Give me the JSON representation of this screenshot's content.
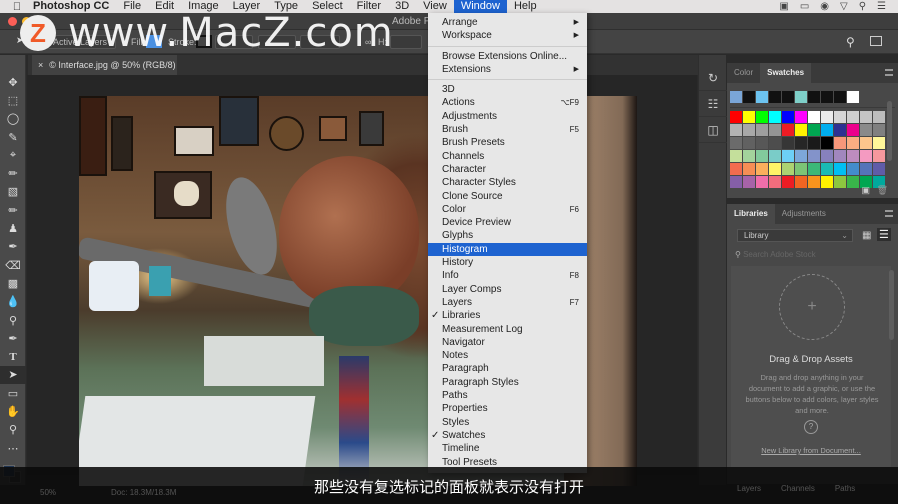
{
  "menubar": {
    "app_name": "Photoshop CC",
    "items": [
      "File",
      "Edit",
      "Image",
      "Layer",
      "Type",
      "Select",
      "Filter",
      "3D",
      "View",
      "Window",
      "Help"
    ],
    "active": "Window"
  },
  "titlebar": {
    "title": "Adobe P"
  },
  "optionsbar": {
    "layers_select": "Active Layers",
    "fill_label": "Fill:",
    "stroke_label": "Stroke:",
    "h_label": "H:"
  },
  "document_tab": {
    "title": "© Interface.jpg @ 50% (RGB/8)",
    "close": "×"
  },
  "window_menu": {
    "groups": [
      [
        {
          "label": "Arrange",
          "submenu": true
        },
        {
          "label": "Workspace",
          "submenu": true
        }
      ],
      [
        {
          "label": "Browse Extensions Online..."
        },
        {
          "label": "Extensions",
          "submenu": true
        }
      ],
      [
        {
          "label": "3D"
        },
        {
          "label": "Actions",
          "shortcut": "⌥F9"
        },
        {
          "label": "Adjustments"
        },
        {
          "label": "Brush",
          "shortcut": "F5"
        },
        {
          "label": "Brush Presets"
        },
        {
          "label": "Channels"
        },
        {
          "label": "Character"
        },
        {
          "label": "Character Styles"
        },
        {
          "label": "Clone Source"
        },
        {
          "label": "Color",
          "shortcut": "F6"
        },
        {
          "label": "Device Preview"
        },
        {
          "label": "Glyphs"
        },
        {
          "label": "Histogram",
          "highlighted": true
        },
        {
          "label": "History"
        },
        {
          "label": "Info",
          "shortcut": "F8"
        },
        {
          "label": "Layer Comps"
        },
        {
          "label": "Layers",
          "shortcut": "F7"
        },
        {
          "label": "Libraries",
          "checked": true
        },
        {
          "label": "Measurement Log"
        },
        {
          "label": "Navigator"
        },
        {
          "label": "Notes"
        },
        {
          "label": "Paragraph"
        },
        {
          "label": "Paragraph Styles"
        },
        {
          "label": "Paths"
        },
        {
          "label": "Properties"
        },
        {
          "label": "Styles"
        },
        {
          "label": "Swatches",
          "checked": true
        },
        {
          "label": "Timeline"
        },
        {
          "label": "Tool Presets"
        }
      ]
    ]
  },
  "swatches_panel": {
    "tabs": [
      "Color",
      "Swatches"
    ],
    "active_tab": "Swatches",
    "recent": [
      "#7aa6d8",
      "#111111",
      "#6cc3f0",
      "#111111",
      "#111111",
      "#7ecfc8",
      "#111111",
      "#111111",
      "#111111",
      "#ffffff"
    ],
    "rows": [
      [
        "#ff0000",
        "#ffff00",
        "#00ff00",
        "#00ffff",
        "#0000ff",
        "#ff00ff",
        "#ffffff",
        "#ebebeb",
        "#d6d6d6",
        "#cfcfcf",
        "#c4c4c4",
        "#bdbdbd"
      ],
      [
        "#b3b3b3",
        "#a8a8a8",
        "#9e9e9e",
        "#949494",
        "#ed1c24",
        "#fff200",
        "#00a651",
        "#00aeef",
        "#2e3192",
        "#ec008c",
        "#8a8a8a",
        "#808080"
      ],
      [
        "#6b6b6b",
        "#616161",
        "#575757",
        "#4d4d4d",
        "#363636",
        "#262626",
        "#1a1a1a",
        "#000000",
        "#f7977a",
        "#fbad82",
        "#fdc68c",
        "#fff799"
      ],
      [
        "#c4df9b",
        "#a3d39c",
        "#82ca9c",
        "#7accc8",
        "#6dcff6",
        "#7da7d9",
        "#8393ca",
        "#8781bd",
        "#a187be",
        "#bd8cbf",
        "#f49ac1",
        "#f6989d"
      ],
      [
        "#f26c4f",
        "#f68e55",
        "#fbaf5c",
        "#fff467",
        "#acd372",
        "#7cc576",
        "#3bb878",
        "#1abbb4",
        "#00bff3",
        "#438ccb",
        "#5574b9",
        "#605ca8"
      ],
      [
        "#855fa8",
        "#a763a8",
        "#f06eaa",
        "#f26d7d",
        "#ed1c24",
        "#f26522",
        "#f7941d",
        "#fff200",
        "#8dc63f",
        "#39b54a",
        "#00a651",
        "#00a99d"
      ]
    ]
  },
  "libraries_panel": {
    "tabs": [
      "Libraries",
      "Adjustments"
    ],
    "active_tab": "Libraries",
    "library_select": "Library",
    "search_placeholder": "Search Adobe Stock",
    "dnd_title": "Drag & Drop Assets",
    "dnd_body": "Drag and drop anything in your document to add a graphic, or use the buttons below to add colors, layer styles and more.",
    "new_library_link": "New Library from Document..."
  },
  "bottom_panel": {
    "tabs": [
      "Layers",
      "Channels",
      "Paths"
    ]
  },
  "statusbar": {
    "zoom": "50%",
    "doc": "Doc: 18.3M/18.3M"
  },
  "watermark": {
    "logo": "Z",
    "text": "www.MacZ.com"
  },
  "subtitle": "那些没有复选标记的面板就表示没有打开"
}
